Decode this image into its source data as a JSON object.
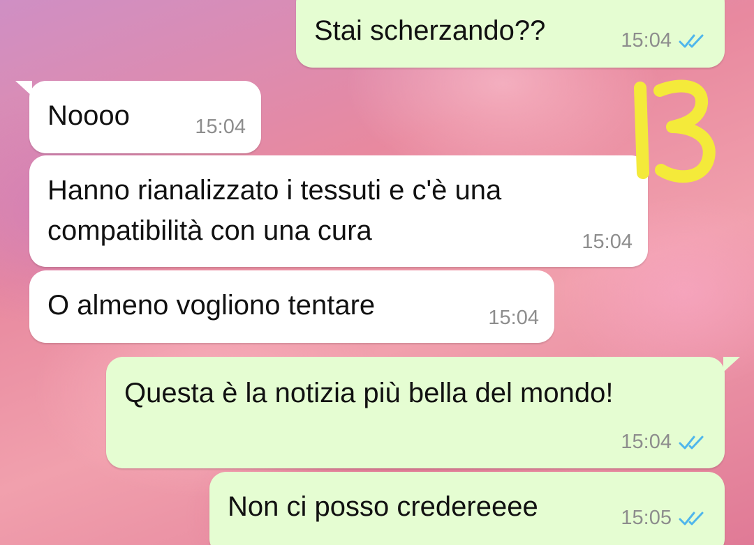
{
  "messages": [
    {
      "direction": "outgoing",
      "text": "Stai scherzando??",
      "time": "15:04",
      "status_icon": "double-check-read-icon"
    },
    {
      "direction": "incoming",
      "text": "Noooo",
      "time": "15:04"
    },
    {
      "direction": "incoming",
      "text_lines": [
        "Hanno rianalizzato i tessuti e c'è una",
        "compatibilità con una cura"
      ],
      "time": "15:04"
    },
    {
      "direction": "incoming",
      "text": "O almeno vogliono tentare",
      "time": "15:04"
    },
    {
      "direction": "outgoing",
      "text": "Questa è la notizia più bella del mondo!",
      "time": "15:04",
      "status_icon": "double-check-read-icon"
    },
    {
      "direction": "outgoing",
      "text": "Non ci posso credereeee",
      "time": "15:05",
      "status_icon": "double-check-read-icon"
    }
  ],
  "annotation": {
    "text": "13",
    "color": "#f4ea3a"
  },
  "colors": {
    "incoming_bubble": "#ffffff",
    "outgoing_bubble": "#e5fdd2",
    "timestamp": "#8d8d8d",
    "read_ticks": "#4fb6ec"
  }
}
